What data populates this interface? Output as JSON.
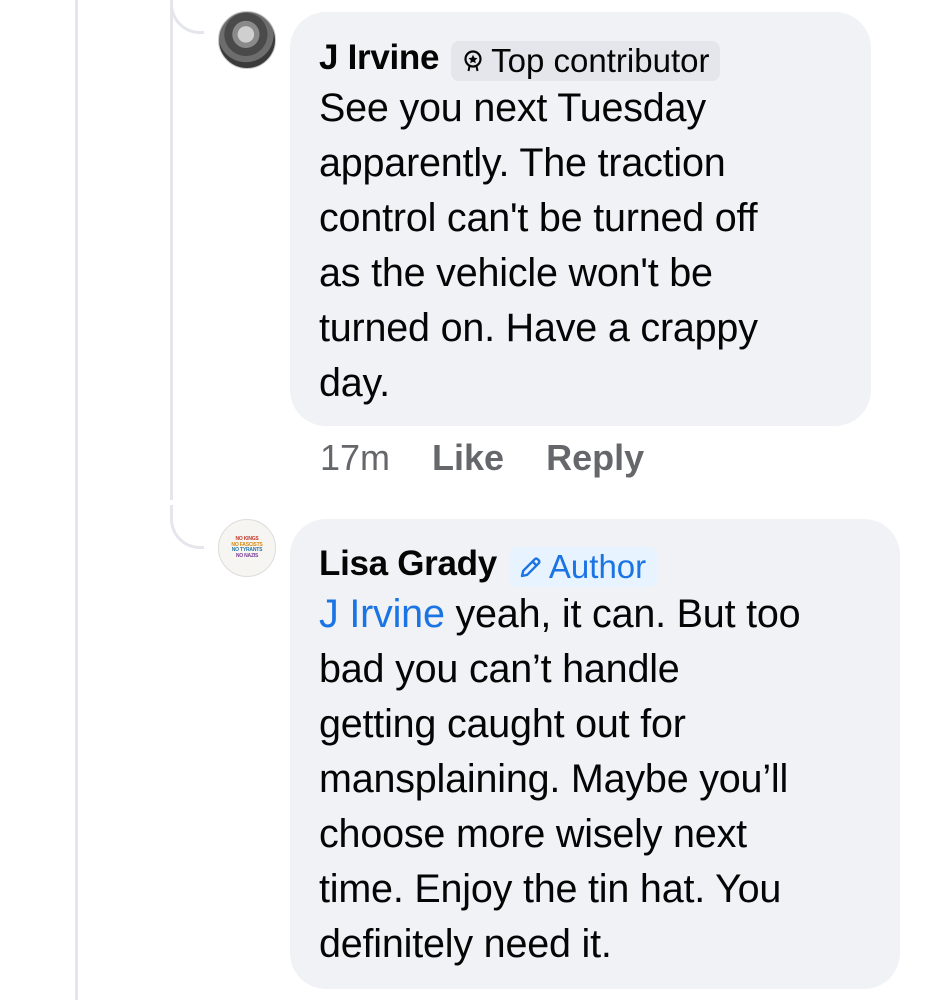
{
  "comments": [
    {
      "author": "J Irvine",
      "badge": "Top contributor",
      "badge_icon": "top-contributor-badge-icon",
      "text": "See you next Tuesday\napparently. The traction\ncontrol can't be turned off\nas the vehicle won't be\nturned on. Have a crappy\nday.",
      "time": "17m",
      "like_label": "Like",
      "reply_label": "Reply"
    },
    {
      "author": "Lisa Grady",
      "badge": "Author",
      "badge_icon": "pencil-icon",
      "mention": "J Irvine",
      "text": " yeah, it can. But too\nbad you can’t handle\ngetting caught out for\nmansplaining. Maybe you’ll\nchoose more wisely next\ntime. Enjoy the tin hat. You\ndefinitely need it.",
      "avatar_text": [
        "NO KINGS",
        "NO FASCISTS",
        "NO TYRANTS",
        "NO NAZIS"
      ]
    }
  ],
  "colors": {
    "bubble": "#f0f2f5",
    "link": "#1b74e4",
    "muted": "#65676b",
    "author_badge_bg": "#e7f3ff"
  }
}
